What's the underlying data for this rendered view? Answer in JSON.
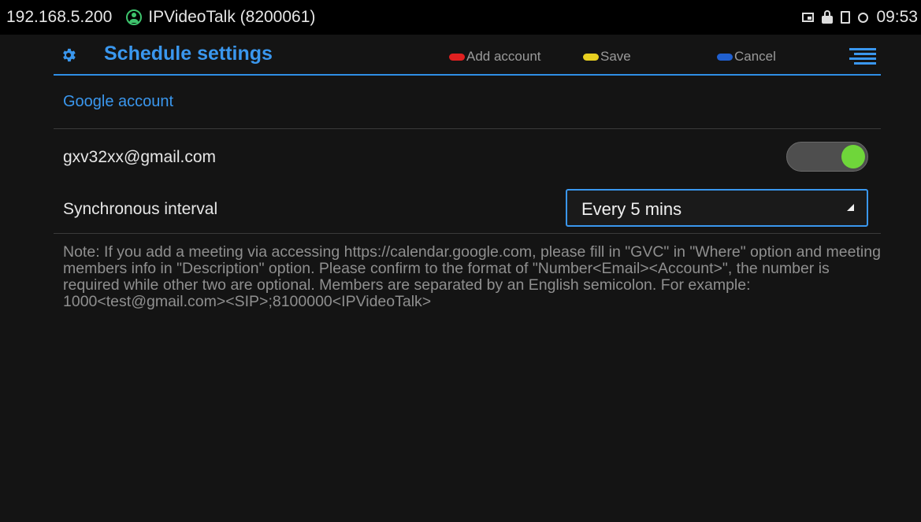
{
  "status_bar": {
    "ip": "192.168.5.200",
    "account": "IPVideoTalk (8200061)",
    "time": "09:53",
    "icons": [
      "screen-icon",
      "lock-icon",
      "sd-card-icon",
      "sync-icon"
    ]
  },
  "header": {
    "title": "Schedule settings",
    "actions": [
      {
        "label": "Add account",
        "color": "#e02020"
      },
      {
        "label": "Save",
        "color": "#e8d020"
      },
      {
        "label": "Cancel",
        "color": "#2060d0"
      }
    ]
  },
  "section": {
    "title": "Google account"
  },
  "account_row": {
    "email": "gxv32xx@gmail.com",
    "enabled": true
  },
  "interval_row": {
    "label": "Synchronous interval",
    "value": "Every 5 mins"
  },
  "note": "Note: If you add a meeting via accessing https://calendar.google.com, please fill in \"GVC\" in \"Where\" option and meeting members info in \"Description\" option. Please confirm to the format of \"Number<Email><Account>\", the number is required while other two are optional. Members are separated by an English semicolon. For example: 1000<test@gmail.com><SIP>;8100000<IPVideoTalk>",
  "colors": {
    "accent": "#3a97ee",
    "toggle_on": "#6fd63a"
  }
}
